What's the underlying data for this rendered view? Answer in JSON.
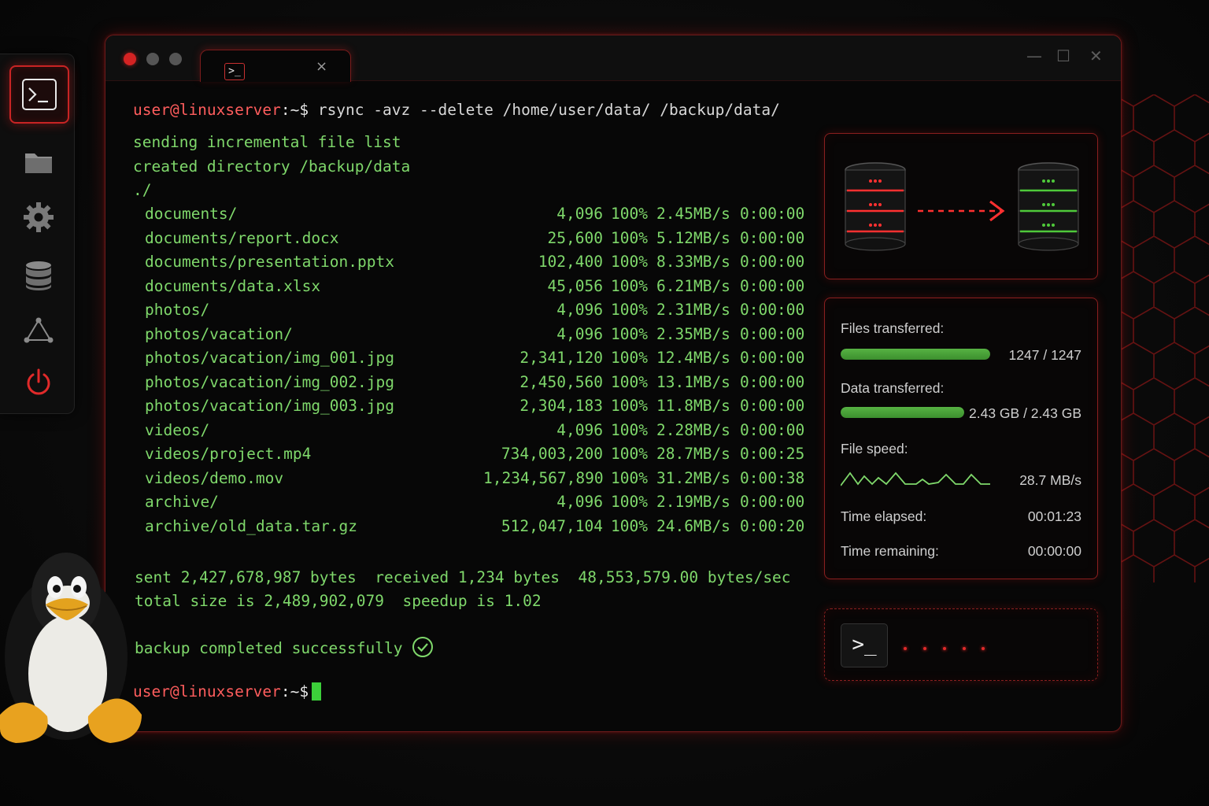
{
  "window": {
    "tab_icon_text": ">_",
    "tab_close": "×",
    "controls": {
      "minimize": "—",
      "maximize": "☐",
      "close": "✕"
    },
    "traffic_colors": [
      "#d42323",
      "#555555",
      "#555555"
    ]
  },
  "dock": {
    "items": [
      {
        "name": "terminal-icon",
        "active": true
      },
      {
        "name": "folder-icon",
        "active": false
      },
      {
        "name": "gear-icon",
        "active": false
      },
      {
        "name": "database-icon",
        "active": false
      },
      {
        "name": "network-icon",
        "active": false
      },
      {
        "name": "power-icon",
        "active": false
      }
    ],
    "accent_color": "#d42323"
  },
  "terminal": {
    "prompt_user": "user@linuxserver",
    "prompt_sep": ":~$",
    "command": "rsync -avz --delete /home/user/data/ /backup/data/",
    "header_lines": [
      "sending incremental file list",
      "created directory /backup/data",
      "./"
    ],
    "files": [
      {
        "path": "documents/",
        "size": "4,096",
        "pct": "100%",
        "rate": "2.45MB/s",
        "time": "0:00:00"
      },
      {
        "path": "documents/report.docx",
        "size": "25,600",
        "pct": "100%",
        "rate": "5.12MB/s",
        "time": "0:00:00"
      },
      {
        "path": "documents/presentation.pptx",
        "size": "102,400",
        "pct": "100%",
        "rate": "8.33MB/s",
        "time": "0:00:00"
      },
      {
        "path": "documents/data.xlsx",
        "size": "45,056",
        "pct": "100%",
        "rate": "6.21MB/s",
        "time": "0:00:00"
      },
      {
        "path": "photos/",
        "size": "4,096",
        "pct": "100%",
        "rate": "2.31MB/s",
        "time": "0:00:00"
      },
      {
        "path": "photos/vacation/",
        "size": "4,096",
        "pct": "100%",
        "rate": "2.35MB/s",
        "time": "0:00:00"
      },
      {
        "path": "photos/vacation/img_001.jpg",
        "size": "2,341,120",
        "pct": "100%",
        "rate": "12.4MB/s",
        "time": "0:00:00"
      },
      {
        "path": "photos/vacation/img_002.jpg",
        "size": "2,450,560",
        "pct": "100%",
        "rate": "13.1MB/s",
        "time": "0:00:00"
      },
      {
        "path": "photos/vacation/img_003.jpg",
        "size": "2,304,183",
        "pct": "100%",
        "rate": "11.8MB/s",
        "time": "0:00:00"
      },
      {
        "path": "videos/",
        "size": "4,096",
        "pct": "100%",
        "rate": "2.28MB/s",
        "time": "0:00:00"
      },
      {
        "path": "videos/project.mp4",
        "size": "734,003,200",
        "pct": "100%",
        "rate": "28.7MB/s",
        "time": "0:00:25"
      },
      {
        "path": "videos/demo.mov",
        "size": "1,234,567,890",
        "pct": "100%",
        "rate": "31.2MB/s",
        "time": "0:00:38"
      },
      {
        "path": "archive/",
        "size": "4,096",
        "pct": "100%",
        "rate": "2.19MB/s",
        "time": "0:00:00"
      },
      {
        "path": "archive/old_data.tar.gz",
        "size": "512,047,104",
        "pct": "100%",
        "rate": "24.6MB/s",
        "time": "0:00:20"
      }
    ],
    "summary_1": "sent 2,427,678,987 bytes  received 1,234 bytes  48,553,579.00 bytes/sec",
    "summary_2": "total size is 2,489,902,079  speedup is 1.02",
    "success_message": "backup completed successfully",
    "text_color": "#7fd86b",
    "prompt_color": "#ff5d5d"
  },
  "stats": {
    "files_label": "Files transferred:",
    "files_value": "1247 / 1247",
    "files_fraction": 1.0,
    "data_label": "Data transferred:",
    "data_value": "2.43 GB / 2.43 GB",
    "data_fraction": 1.0,
    "speed_label": "File speed:",
    "speed_value": "28.7 MB/s",
    "elapsed_label": "Time elapsed:",
    "elapsed_value": "00:01:23",
    "remaining_label": "Time remaining:",
    "remaining_value": "00:00:00"
  },
  "mini_terminal": {
    "icon_text": ">_"
  },
  "colors": {
    "accent_red": "#d42323",
    "green": "#4fae3c",
    "panel_border": "#8a1f1f"
  }
}
